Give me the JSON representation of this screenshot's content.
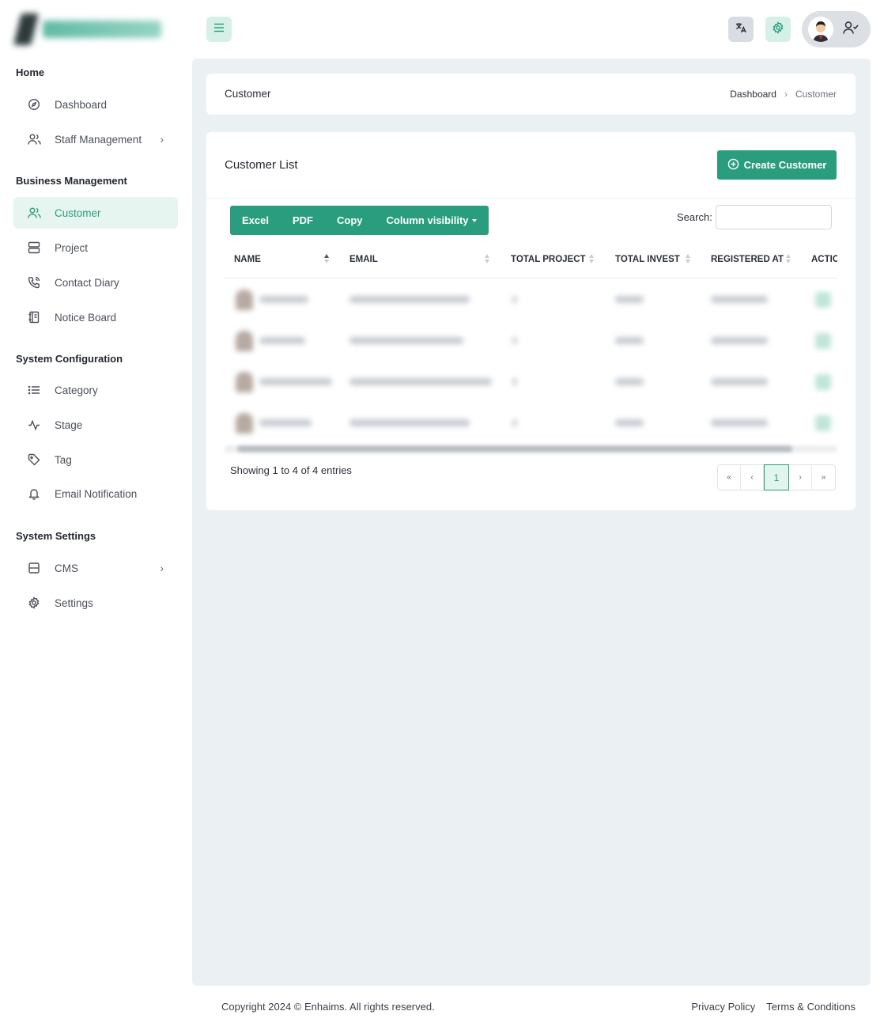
{
  "sidebar": {
    "sections": [
      {
        "title": "Home"
      },
      {
        "title": "Business Management"
      },
      {
        "title": "System Configuration"
      },
      {
        "title": "System Settings"
      }
    ],
    "items": [
      {
        "label": "Dashboard",
        "icon": "dashboard-icon"
      },
      {
        "label": "Staff Management",
        "icon": "users-icon",
        "has_submenu": true
      },
      {
        "label": "Customer",
        "icon": "users-icon",
        "active": true
      },
      {
        "label": "Project",
        "icon": "server-icon"
      },
      {
        "label": "Contact Diary",
        "icon": "phone-icon"
      },
      {
        "label": "Notice Board",
        "icon": "notebook-icon"
      },
      {
        "label": "Category",
        "icon": "list-icon"
      },
      {
        "label": "Stage",
        "icon": "activity-icon"
      },
      {
        "label": "Tag",
        "icon": "tag-icon"
      },
      {
        "label": "Email Notification",
        "icon": "bell-icon"
      },
      {
        "label": "CMS",
        "icon": "layout-icon",
        "has_submenu": true
      },
      {
        "label": "Settings",
        "icon": "gear-icon"
      }
    ]
  },
  "breadcrumb": {
    "page_title": "Customer",
    "trail": [
      "Dashboard",
      "Customer"
    ]
  },
  "customer_list": {
    "title": "Customer List",
    "create_button": "Create Customer",
    "export_buttons": [
      "Excel",
      "PDF",
      "Copy",
      "Column visibility"
    ],
    "search_label": "Search:",
    "search_value": "",
    "columns": [
      "NAME",
      "EMAIL",
      "TOTAL PROJECT",
      "TOTAL INVEST",
      "REGISTERED AT",
      "ACTIC"
    ],
    "rows_count_visible": 4,
    "info": "Showing 1 to 4 of 4 entries",
    "pagination": [
      "«",
      "‹",
      "1",
      "›",
      "»"
    ],
    "current_page": "1"
  },
  "footer": {
    "copyright": "Copyright 2024 © Enhaims. All rights reserved.",
    "links": [
      "Privacy Policy",
      "Terms & Conditions"
    ]
  },
  "colors": {
    "accent": "#2a9d7e",
    "accent_light": "#e7f5f1",
    "main_bg": "#ebf0f2"
  }
}
